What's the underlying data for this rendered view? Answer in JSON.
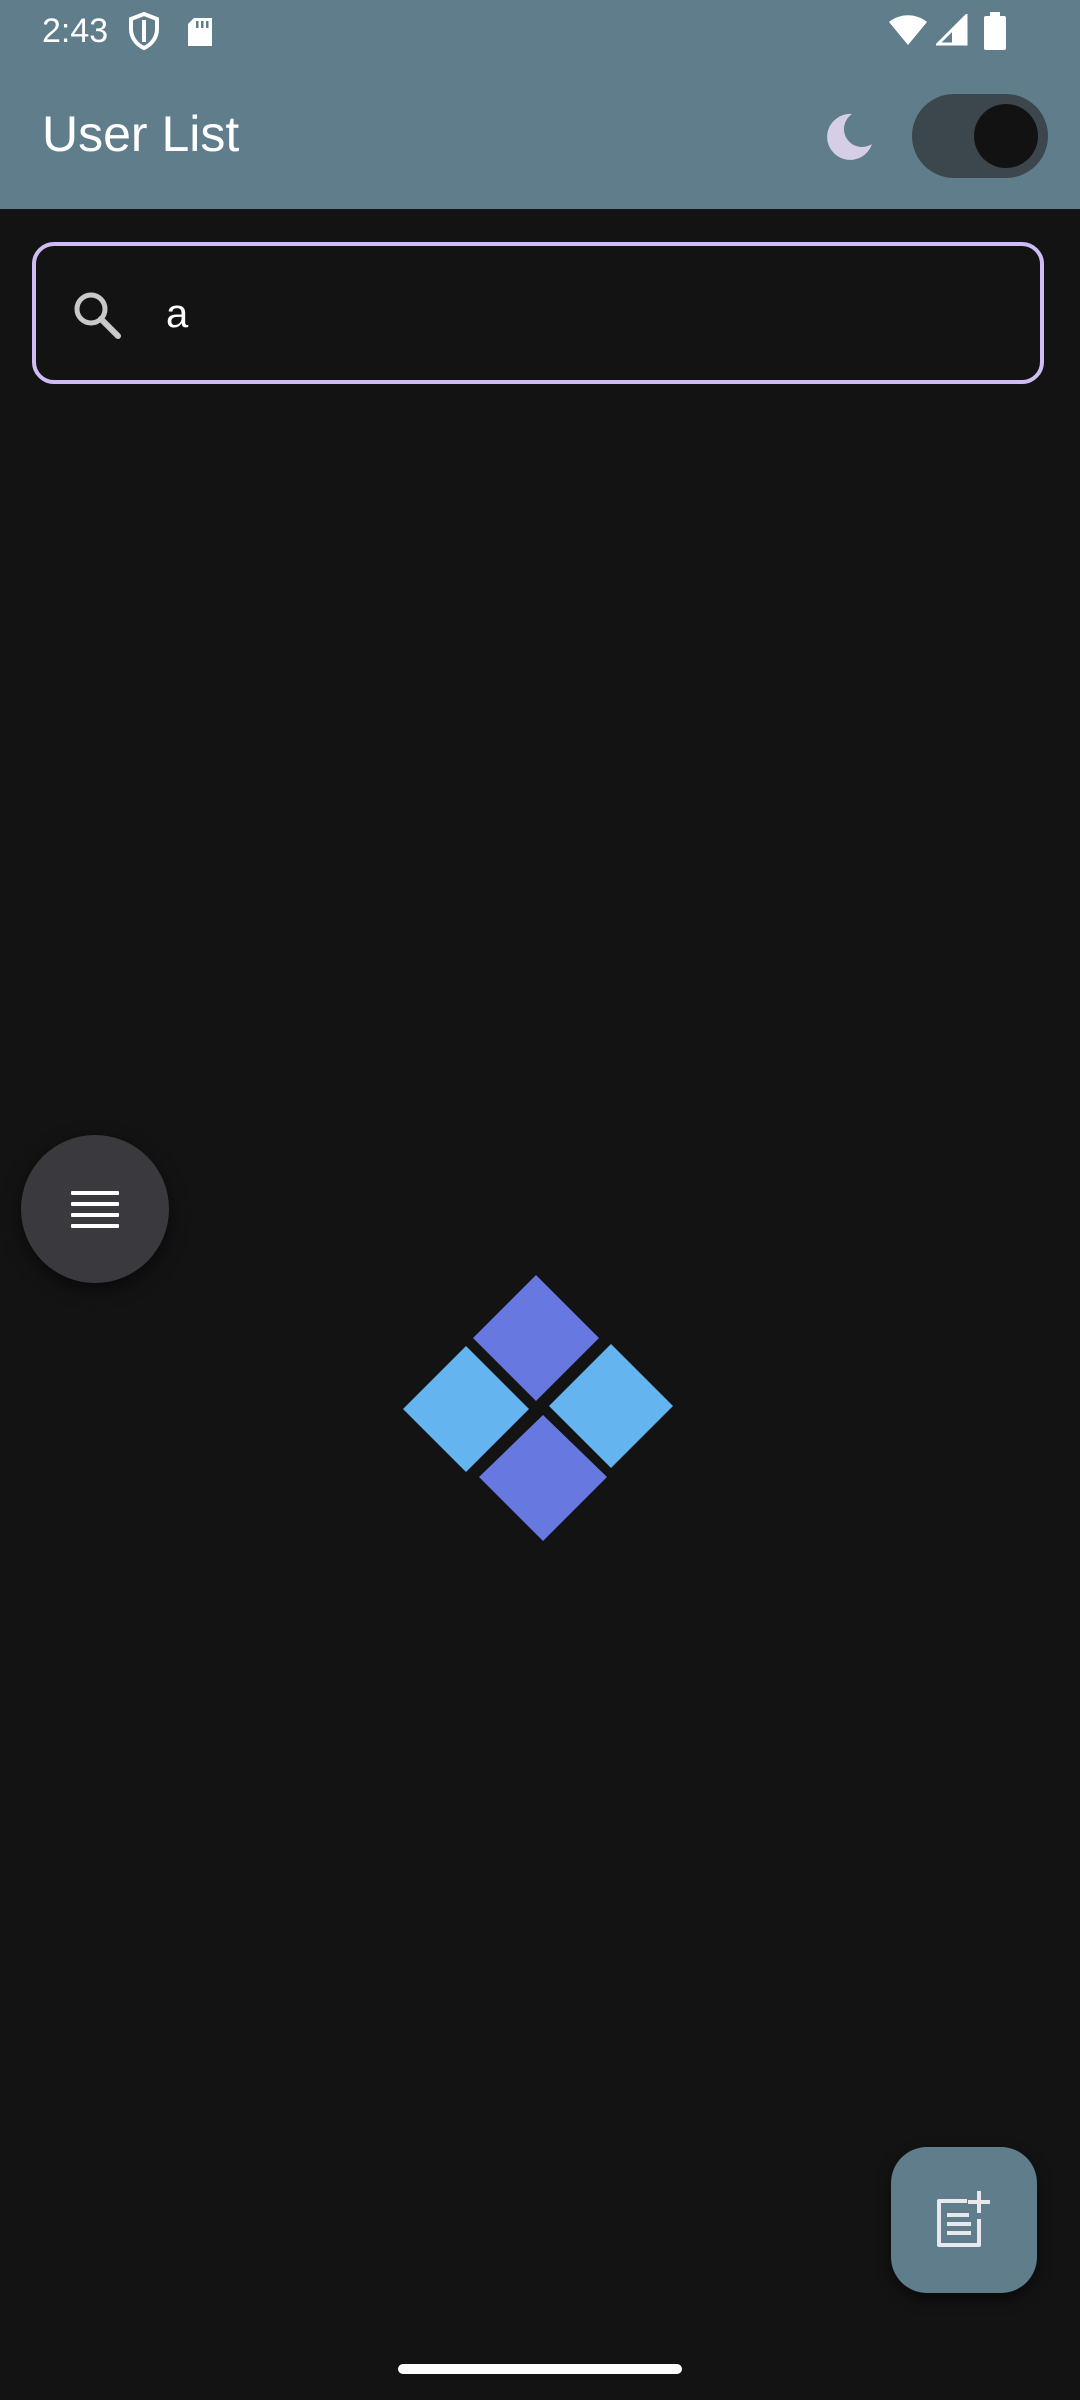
{
  "status_bar": {
    "time": "2:43",
    "icons": [
      "shield-icon",
      "sd-card-icon",
      "wifi-icon",
      "signal-icon",
      "battery-icon"
    ]
  },
  "app_bar": {
    "title": "User List",
    "theme_toggle": {
      "icon": "moon-icon",
      "state": "on"
    },
    "background_color": "#607d8b"
  },
  "search": {
    "value": "a",
    "icon": "search-icon",
    "border_color": "#cfbcf5"
  },
  "menu_button": {
    "icon": "menu-icon"
  },
  "loading_indicator": {
    "icon": "diamond-loader-icon",
    "colors": [
      "#6778e0",
      "#64b4f0"
    ]
  },
  "add_button": {
    "icon": "note-add-icon"
  },
  "colors": {
    "background": "#131313",
    "accent": "#607d8b"
  }
}
